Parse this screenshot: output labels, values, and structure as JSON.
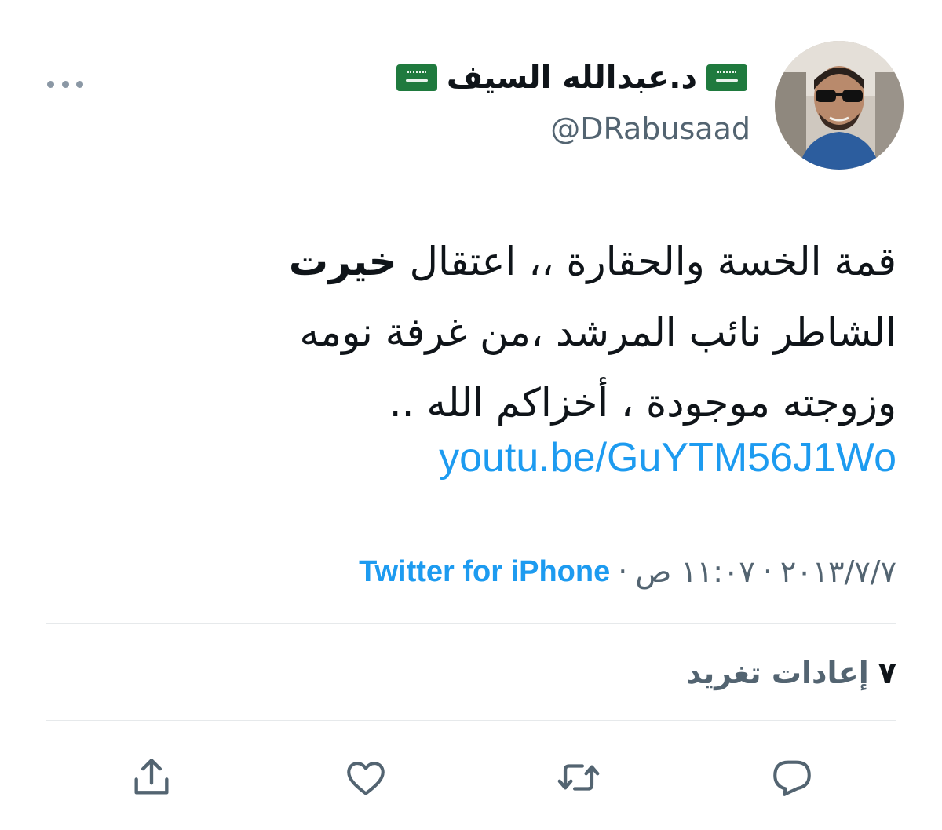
{
  "author": {
    "display_name": "د.عبدالله السيف",
    "handle": "@DRabusaad",
    "flag_icon": "saudi-flag-icon"
  },
  "tweet": {
    "line1_part1": "قمة الخسة والحقارة ،، اعتقال",
    "line1_bold": "خيرت",
    "line2": "الشاطر نائب المرشد ،من غرفة نومه",
    "line3": "وزوجته موجودة ، أخزاكم الله ..",
    "link": "youtu.be/GuYTM56J1Wo"
  },
  "meta": {
    "date": "٢٠١٣/٧/٧",
    "time": "١١:٠٧ ص",
    "separator": "·",
    "source": "Twitter for iPhone"
  },
  "stats": {
    "retweets_count": "٧",
    "retweets_label": "إعادات تغريد"
  },
  "actions": {
    "reply_icon": "reply-icon",
    "retweet_icon": "retweet-icon",
    "like_icon": "heart-icon",
    "share_icon": "share-icon",
    "more_icon": "more-icon"
  },
  "colors": {
    "link": "#1d9bf0",
    "secondary_text": "#536471",
    "primary_text": "#0f1419",
    "flag_green": "#1f7a3e"
  }
}
